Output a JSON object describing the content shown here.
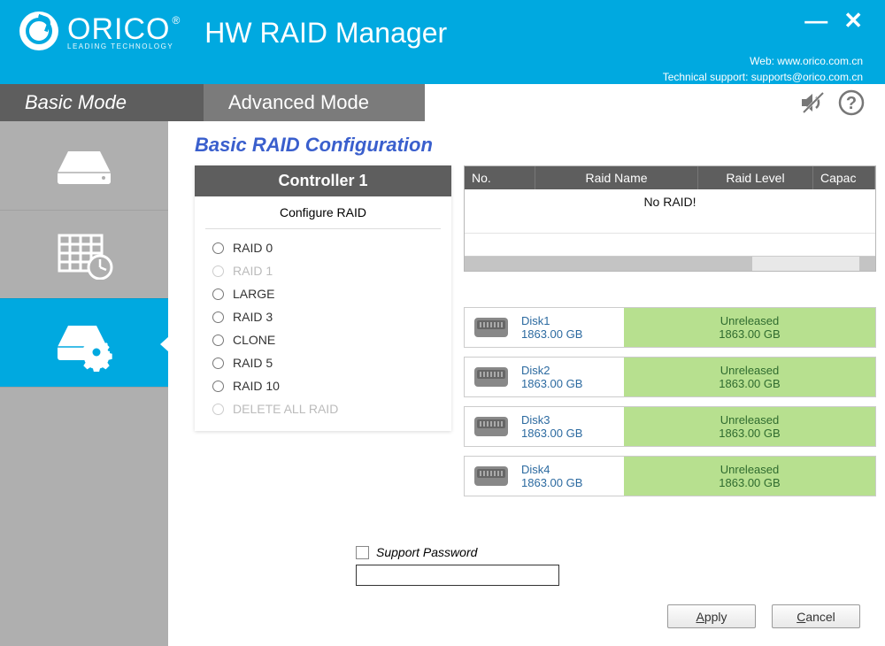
{
  "header": {
    "brand": "ORICO",
    "brand_sub": "LEADING TECHNOLOGY",
    "registered": "®",
    "app_title": "HW RAID Manager",
    "web_label": "Web: www.orico.com.cn",
    "support_label": "Technical support: supports@orico.com.cn"
  },
  "modes": {
    "basic": "Basic Mode",
    "advanced": "Advanced Mode"
  },
  "page_title": "Basic RAID Configuration",
  "controller": {
    "title": "Controller 1",
    "subtitle": "Configure RAID",
    "options": [
      {
        "label": "RAID 0",
        "enabled": true
      },
      {
        "label": "RAID 1",
        "enabled": false
      },
      {
        "label": "LARGE",
        "enabled": true
      },
      {
        "label": "RAID 3",
        "enabled": true
      },
      {
        "label": "CLONE",
        "enabled": true
      },
      {
        "label": "RAID 5",
        "enabled": true
      },
      {
        "label": "RAID 10",
        "enabled": true
      },
      {
        "label": "DELETE ALL RAID",
        "enabled": false
      }
    ]
  },
  "raid_table": {
    "cols": {
      "no": "No.",
      "name": "Raid Name",
      "level": "Raid Level",
      "capacity": "Capac"
    },
    "empty_text": "No RAID!"
  },
  "disks": [
    {
      "name": "Disk1",
      "size": "1863.00 GB",
      "status": "Unreleased",
      "status_size": "1863.00 GB"
    },
    {
      "name": "Disk2",
      "size": "1863.00 GB",
      "status": "Unreleased",
      "status_size": "1863.00 GB"
    },
    {
      "name": "Disk3",
      "size": "1863.00 GB",
      "status": "Unreleased",
      "status_size": "1863.00 GB"
    },
    {
      "name": "Disk4",
      "size": "1863.00 GB",
      "status": "Unreleased",
      "status_size": "1863.00 GB"
    }
  ],
  "password": {
    "label": "Support Password"
  },
  "buttons": {
    "apply": "Apply",
    "cancel": "Cancel"
  }
}
